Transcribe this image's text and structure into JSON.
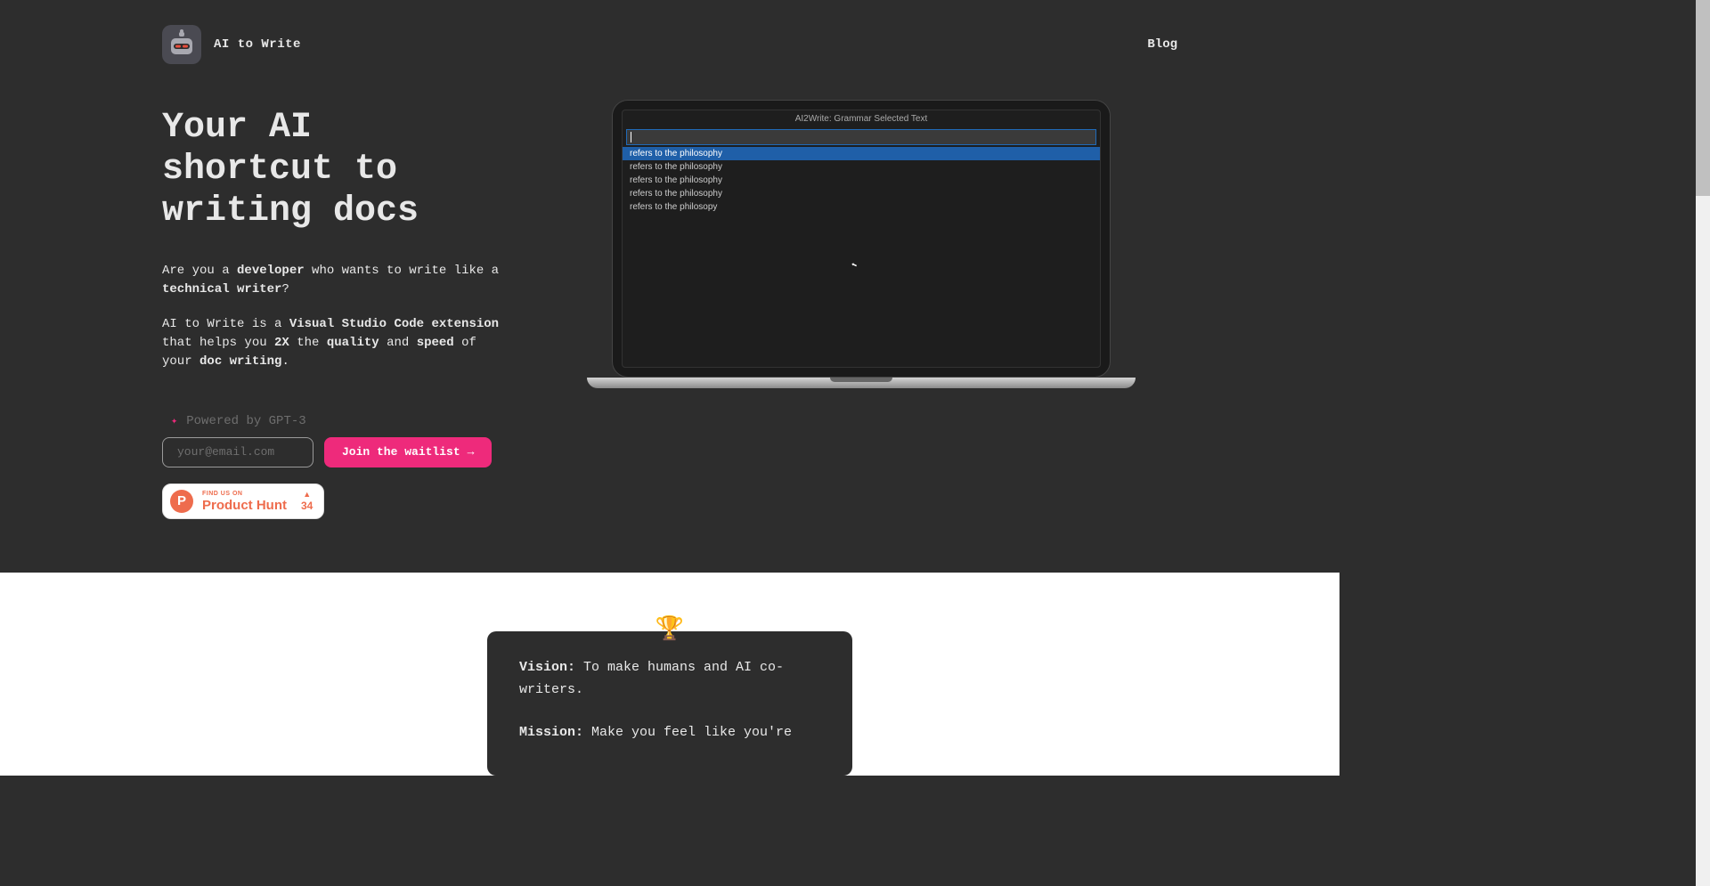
{
  "header": {
    "logo_text": "AI to Write",
    "nav_blog": "Blog"
  },
  "hero": {
    "title": "Your AI shortcut to writing docs",
    "para1_a": "Are you a ",
    "para1_b": "developer",
    "para1_c": " who wants to write like a ",
    "para1_d": "technical writer",
    "para1_e": "?",
    "para2_a": "AI to Write is a ",
    "para2_b": "Visual Studio Code extension",
    "para2_c": " that helps you ",
    "para2_d": "2X",
    "para2_e": " the ",
    "para2_f": "quality",
    "para2_g": " and ",
    "para2_h": "speed",
    "para2_i": " of your ",
    "para2_j": "doc writing",
    "para2_k": ".",
    "powered_by": "Powered by GPT-3",
    "email_placeholder": "your@email.com",
    "waitlist_btn": "Join the waitlist",
    "ph_findus": "FIND US ON",
    "ph_name": "Product Hunt",
    "ph_count": "34"
  },
  "laptop": {
    "title": "AI2Write: Grammar Selected Text",
    "items": [
      "refers to the philosophy",
      "refers to the philosophy",
      "refers to the philosophy",
      "refers to the philosophy",
      "refers to the philosopy"
    ]
  },
  "vision": {
    "label1": "Vision:",
    "text1": " To make humans and AI co-writers.",
    "label2": "Mission:",
    "text2": " Make you feel like you're"
  }
}
